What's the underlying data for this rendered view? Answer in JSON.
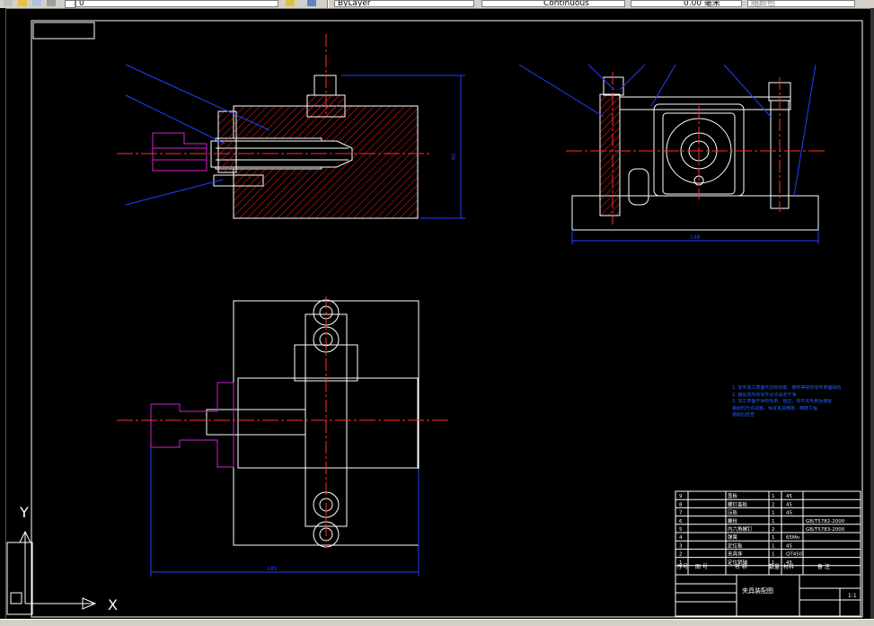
{
  "toolbar": {
    "layer_value": "0",
    "color_value": "ByLayer",
    "linetype_value": "Continuous",
    "lineweight_value": "0.00 毫米",
    "plotstyle_value": "随颜色"
  },
  "ucs": {
    "x_label": "X",
    "y_label": "Y"
  },
  "colors": {
    "background": "#000000",
    "frame": "#ffffff",
    "hatch": "#ff2020",
    "dimension": "#2040ff",
    "leader": "#2040ff",
    "part_magenta": "#d020d0",
    "center": "#ff3030"
  },
  "drawing": {
    "dims": {
      "front_height": "80",
      "side_width": "148",
      "top_width": "185"
    },
    "tech_notes": [
      "1. 零件加工表面不应有划痕、擦伤等损伤零件表面缺陷",
      "2. 装配前所有零件必须清洗干净",
      "3. 加工表面不得有毛刺、锐边，零件去毛刺后装配",
      "   装配时允许调整，保证夹具精度，精度工程",
      "   装配后检查"
    ],
    "bom": {
      "rows": [
        {
          "no": "9",
          "name": "盖板",
          "qty": "1",
          "material": "45",
          "note": ""
        },
        {
          "no": "8",
          "name": "螺钉盖板",
          "qty": "2",
          "material": "45",
          "note": ""
        },
        {
          "no": "7",
          "name": "压板",
          "qty": "1",
          "material": "45",
          "note": ""
        },
        {
          "no": "6",
          "name": "螺栓",
          "qty": "1",
          "material": "",
          "note": "GB/T5782-2000"
        },
        {
          "no": "5",
          "name": "内六角螺钉",
          "qty": "2",
          "material": "",
          "note": "GB/T5783-2000"
        },
        {
          "no": "4",
          "name": "弹簧",
          "qty": "1",
          "material": "65Mn",
          "note": ""
        },
        {
          "no": "3",
          "name": "定位板",
          "qty": "1",
          "material": "45",
          "note": ""
        },
        {
          "no": "2",
          "name": "夹具体",
          "qty": "1",
          "material": "QT450",
          "note": ""
        },
        {
          "no": "1",
          "name": "定位销轴",
          "qty": "1",
          "material": "45",
          "note": ""
        }
      ],
      "headers": {
        "no": "序号",
        "code": "图 号",
        "name": "名 称",
        "qty": "数量",
        "material": "材料",
        "note": "备 注"
      }
    },
    "title_block": {
      "title": "夹具装配图",
      "scale": "1:1"
    }
  }
}
